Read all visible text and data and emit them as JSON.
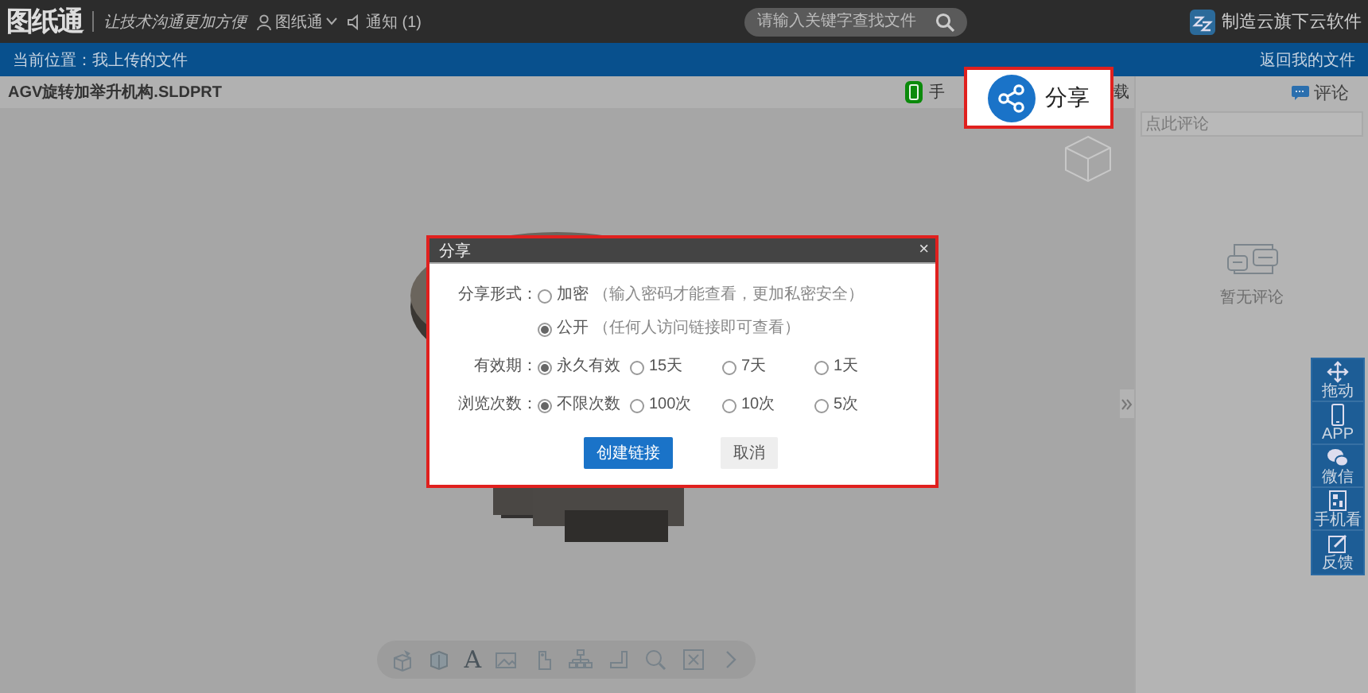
{
  "header": {
    "logo": "图纸通",
    "slogan": "让技术沟通更加方便",
    "user": "图纸通",
    "notice": "通知 (1)",
    "search": {
      "placeholder": "请输入关键字查找文件"
    },
    "brand": "制造云旗下云软件"
  },
  "breadcrumb": {
    "text": "当前位置：我上传的文件",
    "back_link": "返回我的文件"
  },
  "file": {
    "name": "AGV旋转加举升机构.SLDPRT",
    "actions": [
      "手",
      "载"
    ]
  },
  "toolbar": [
    {
      "kind": "cube-cap"
    },
    {
      "kind": "cube"
    },
    {
      "kind": "letter",
      "label": "A"
    },
    {
      "kind": "image"
    },
    {
      "kind": "part"
    },
    {
      "kind": "tree"
    },
    {
      "kind": "measure"
    },
    {
      "kind": "zoom"
    },
    {
      "kind": "fit"
    },
    {
      "kind": "next"
    }
  ],
  "comments": {
    "title": "评论",
    "placeholder": "点此评论",
    "empty": "暂无评论"
  },
  "side_tools": [
    {
      "kind": "move",
      "label": "拖动"
    },
    {
      "kind": "phone",
      "label": "APP"
    },
    {
      "kind": "wechat",
      "label": "微信"
    },
    {
      "kind": "qr",
      "label": "手机看"
    },
    {
      "kind": "edit",
      "label": "反馈"
    }
  ],
  "dialog": {
    "title": "分享",
    "close": "×",
    "groups": [
      {
        "label": "分享形式：",
        "kind": "stack",
        "options": [
          {
            "label": "加密",
            "hint": "（输入密码才能查看，更加私密安全）",
            "selected": false
          },
          {
            "label": "公开",
            "hint": "（任何人访问链接即可查看）",
            "selected": true
          }
        ]
      },
      {
        "label": "有效期：",
        "kind": "inline",
        "options": [
          {
            "label": "永久有效",
            "selected": true
          },
          {
            "label": "15天",
            "selected": false
          },
          {
            "label": "7天",
            "selected": false
          },
          {
            "label": "1天",
            "selected": false
          }
        ]
      },
      {
        "label": "浏览次数：",
        "kind": "inline",
        "options": [
          {
            "label": "不限次数",
            "selected": true
          },
          {
            "label": "100次",
            "selected": false
          },
          {
            "label": "10次",
            "selected": false
          },
          {
            "label": "5次",
            "selected": false
          }
        ]
      }
    ],
    "buttons": [
      {
        "label": "创建链接",
        "kind": "primary"
      },
      {
        "label": "取消",
        "kind": "secondary"
      }
    ]
  },
  "callout": {
    "label": "分享"
  }
}
